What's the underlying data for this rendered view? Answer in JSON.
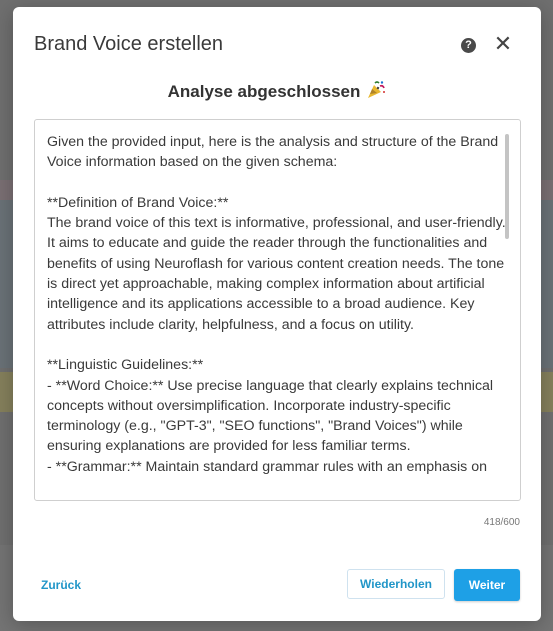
{
  "modal": {
    "title": "Brand Voice erstellen",
    "help_glyph": "?",
    "close_glyph": "✕",
    "subtitle": "Analyse abgeschlossen",
    "subtitle_icon": "party-popper-icon"
  },
  "analysis": {
    "text": "Given the provided input, here is the analysis and structure of the Brand Voice information based on the given schema:\n\n**Definition of Brand Voice:**\nThe brand voice of this text is informative, professional, and user-friendly. It aims to educate and guide the reader through the functionalities and benefits of using Neuroflash for various content creation needs. The tone is direct yet approachable, making complex information about artificial intelligence and its applications accessible to a broad audience. Key attributes include clarity, helpfulness, and a focus on utility.\n\n**Linguistic Guidelines:**\n- **Word Choice:** Use precise language that clearly explains technical concepts without oversimplification. Incorporate industry-specific terminology (e.g., \"GPT-3\", \"SEO functions\", \"Brand Voices\") while ensuring explanations are provided for less familiar terms.\n- **Grammar:** Maintain standard grammar rules with an emphasis on"
  },
  "char_count": "418/600",
  "footer": {
    "back_label": "Zurück",
    "repeat_label": "Wiederholen",
    "next_label": "Weiter"
  },
  "colors": {
    "accent": "#1ea0e6",
    "link": "#2196c8",
    "overlay": "#6f6f6f"
  }
}
